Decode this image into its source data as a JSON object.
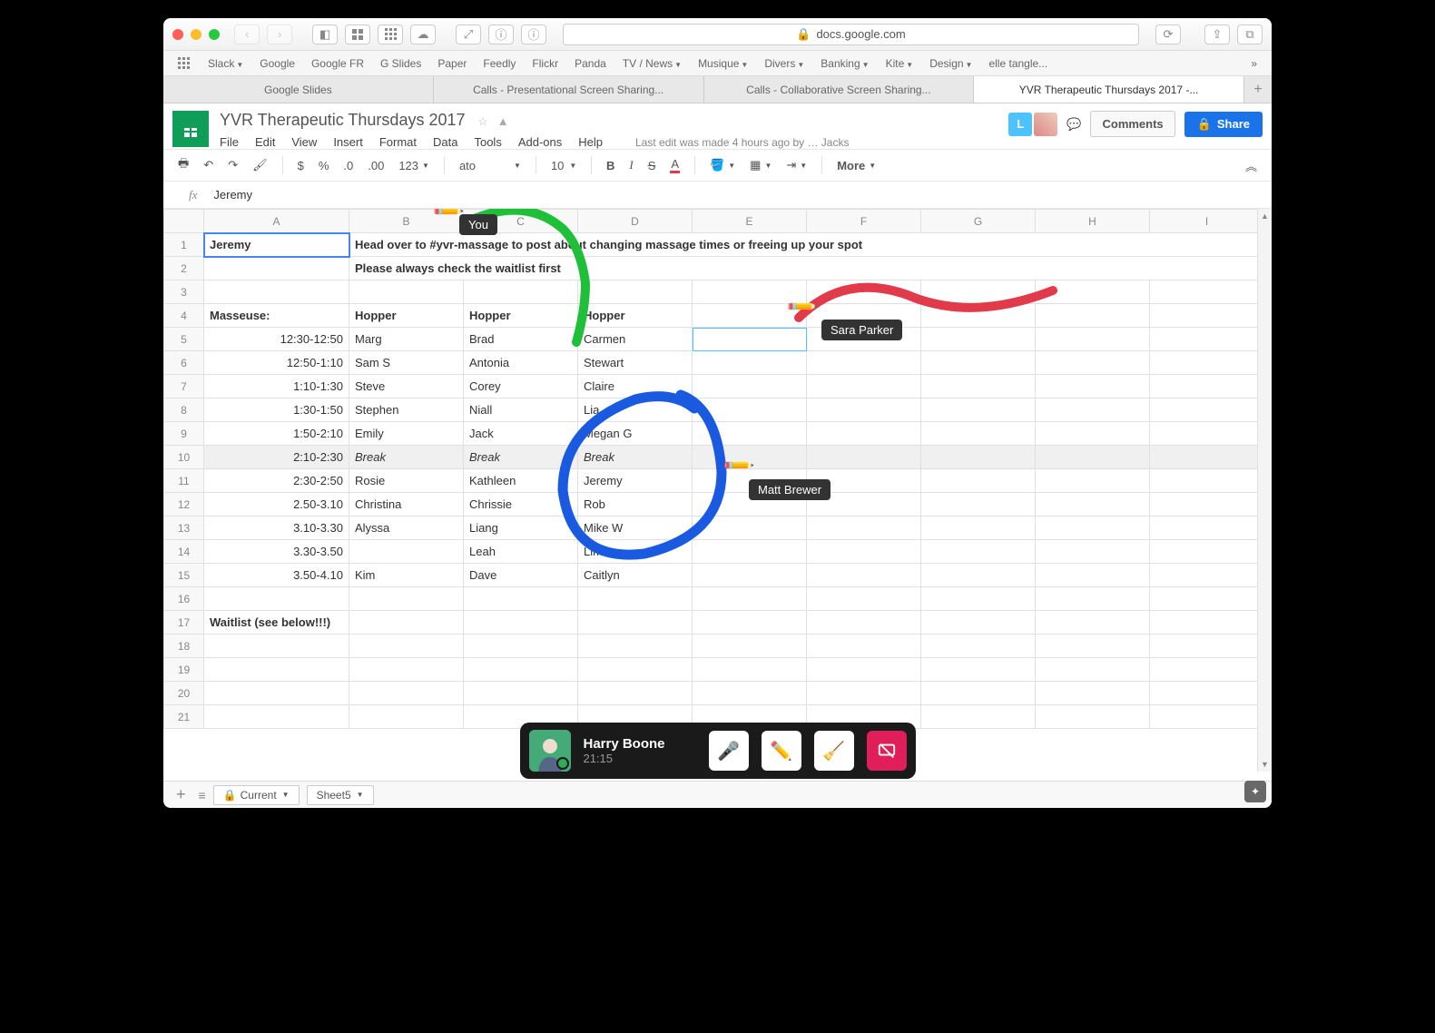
{
  "browser": {
    "url": "docs.google.com",
    "bookmarks": [
      "Slack",
      "Google",
      "Google FR",
      "G Slides",
      "Paper",
      "Feedly",
      "Flickr",
      "Panda",
      "TV / News",
      "Musique",
      "Divers",
      "Banking",
      "Kite",
      "Design",
      "elle tangle..."
    ],
    "bookmark_dropdown": [
      true,
      false,
      false,
      false,
      false,
      false,
      false,
      false,
      true,
      true,
      true,
      true,
      true,
      true,
      false
    ],
    "tabs": [
      "Google Slides",
      "Calls - Presentational Screen Sharing...",
      "Calls - Collaborative Screen Sharing...",
      "YVR Therapeutic Thursdays 2017 -..."
    ],
    "active_tab": 3
  },
  "doc": {
    "title": "YVR Therapeutic Thursdays 2017",
    "menus": [
      "File",
      "Edit",
      "View",
      "Insert",
      "Format",
      "Data",
      "Tools",
      "Add-ons",
      "Help"
    ],
    "last_edit": "Last edit was made 4 hours ago by",
    "last_edit_user_partial": "Jacks",
    "comments_btn": "Comments",
    "share_btn": "Share",
    "presence_initial": "L"
  },
  "toolbar": {
    "font_name": "ato",
    "font_size": "10",
    "more": "More"
  },
  "fx_value": "Jeremy",
  "columns": [
    "A",
    "B",
    "C",
    "D",
    "E",
    "F",
    "G",
    "H",
    "I"
  ],
  "rows": [
    {
      "n": 1,
      "A": "Jeremy",
      "B": "Head over to #yvr-massage to post about changing massage times or freeing up your spot",
      "bold": true,
      "Aselected": true,
      "spanB": 8
    },
    {
      "n": 2,
      "B": "Please always check the waitlist first",
      "bold": true,
      "spanB": 8
    },
    {
      "n": 3
    },
    {
      "n": 4,
      "A": "Masseuse:",
      "B": "Hopper",
      "C": "Hopper",
      "D": "Hopper",
      "bold": true
    },
    {
      "n": 5,
      "A": "12:30-12:50",
      "B": "Marg",
      "C": "Brad",
      "D": "Carmen",
      "Aright": true,
      "Eselected": true
    },
    {
      "n": 6,
      "A": "12:50-1:10",
      "B": "Sam S",
      "C": "Antonia",
      "D": "Stewart",
      "Aright": true
    },
    {
      "n": 7,
      "A": "1:10-1:30",
      "B": "Steve",
      "C": "Corey",
      "D": "Claire",
      "Aright": true
    },
    {
      "n": 8,
      "A": "1:30-1:50",
      "B": "Stephen",
      "C": "Niall",
      "D": "Lia",
      "Aright": true
    },
    {
      "n": 9,
      "A": "1:50-2:10",
      "B": "Emily",
      "C": "Jack",
      "D": "Megan G",
      "Aright": true
    },
    {
      "n": 10,
      "A": "2:10-2:30",
      "B": "Break",
      "C": "Break",
      "D": "Break",
      "Aright": true,
      "grey": true,
      "ital": true
    },
    {
      "n": 11,
      "A": "2:30-2:50",
      "B": "Rosie",
      "C": "Kathleen",
      "D": "Jeremy",
      "Aright": true
    },
    {
      "n": 12,
      "A": "2.50-3.10",
      "B": "Christina",
      "C": "Chrissie",
      "D": "Rob",
      "Aright": true
    },
    {
      "n": 13,
      "A": "3.10-3.30",
      "B": "Alyssa",
      "C": "Liang",
      "D": "Mike W",
      "Aright": true
    },
    {
      "n": 14,
      "A": "3.30-3.50",
      "C": "Leah",
      "D": "Lima",
      "Aright": true
    },
    {
      "n": 15,
      "A": "3.50-4.10",
      "B": "Kim",
      "C": "Dave",
      "D": "Caitlyn",
      "Aright": true
    },
    {
      "n": 16
    },
    {
      "n": 17,
      "A": "Waitlist (see below!!!)",
      "bold": true
    },
    {
      "n": 18
    },
    {
      "n": 19
    },
    {
      "n": 20
    },
    {
      "n": 21
    }
  ],
  "annotations": {
    "you": "You",
    "sara": "Sara Parker",
    "matt": "Matt Brewer",
    "colors": {
      "green": "#1fbf3a",
      "blue": "#1a5ae0",
      "red": "#e13b4b"
    }
  },
  "call": {
    "name": "Harry Boone",
    "time": "21:15"
  },
  "footer": {
    "current": "Current",
    "sheet5": "Sheet5"
  }
}
